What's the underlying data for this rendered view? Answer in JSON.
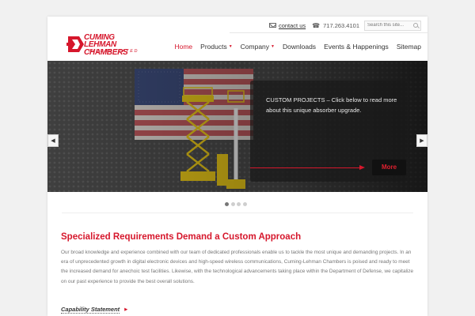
{
  "utility": {
    "contact_label": "contact us",
    "phone_icon_glyph": "☎",
    "phone": "717.263.4101",
    "search_placeholder": "Search this site..."
  },
  "logo": {
    "line1": "CUMING",
    "line2": "LEHMAN CHAMBERS",
    "line3": "INCORPORATED"
  },
  "nav": {
    "items": [
      {
        "label": "Home",
        "active": true,
        "dropdown": false
      },
      {
        "label": "Products",
        "active": false,
        "dropdown": true
      },
      {
        "label": "Company",
        "active": false,
        "dropdown": true
      },
      {
        "label": "Downloads",
        "active": false,
        "dropdown": false
      },
      {
        "label": "Events & Happenings",
        "active": false,
        "dropdown": false
      },
      {
        "label": "Sitemap",
        "active": false,
        "dropdown": false
      }
    ],
    "dropdown_glyph": "▼"
  },
  "slider": {
    "caption": "CUSTOM PROJECTS  –  Click below to read more about this unique absorber upgrade.",
    "more_label": "More",
    "prev_glyph": "◀",
    "next_glyph": "▶",
    "slide_count": 4,
    "active_slide": 1
  },
  "content": {
    "heading": "Specialized Requirements Demand a Custom Approach",
    "body": "Our broad knowledge and experience combined with our team of dedicated professionals enable us to tackle the most unique and demanding projects. In an era of unprecedented growth in digital electronic devices and high-speed wireless communications, Cuming-Lehman Chambers is poised and ready to meet the increased demand for anechoic test facilities. Likewise, with the technological advancements taking place within the Department of Defense, we capitalize on our past experience to provide the best overall solutions.",
    "link_label": "Capability Statement",
    "link_glyph": "▶"
  },
  "colors": {
    "brand_red": "#d6172c",
    "page_bg": "#f1f1f1",
    "caption_bg": "#191919"
  }
}
